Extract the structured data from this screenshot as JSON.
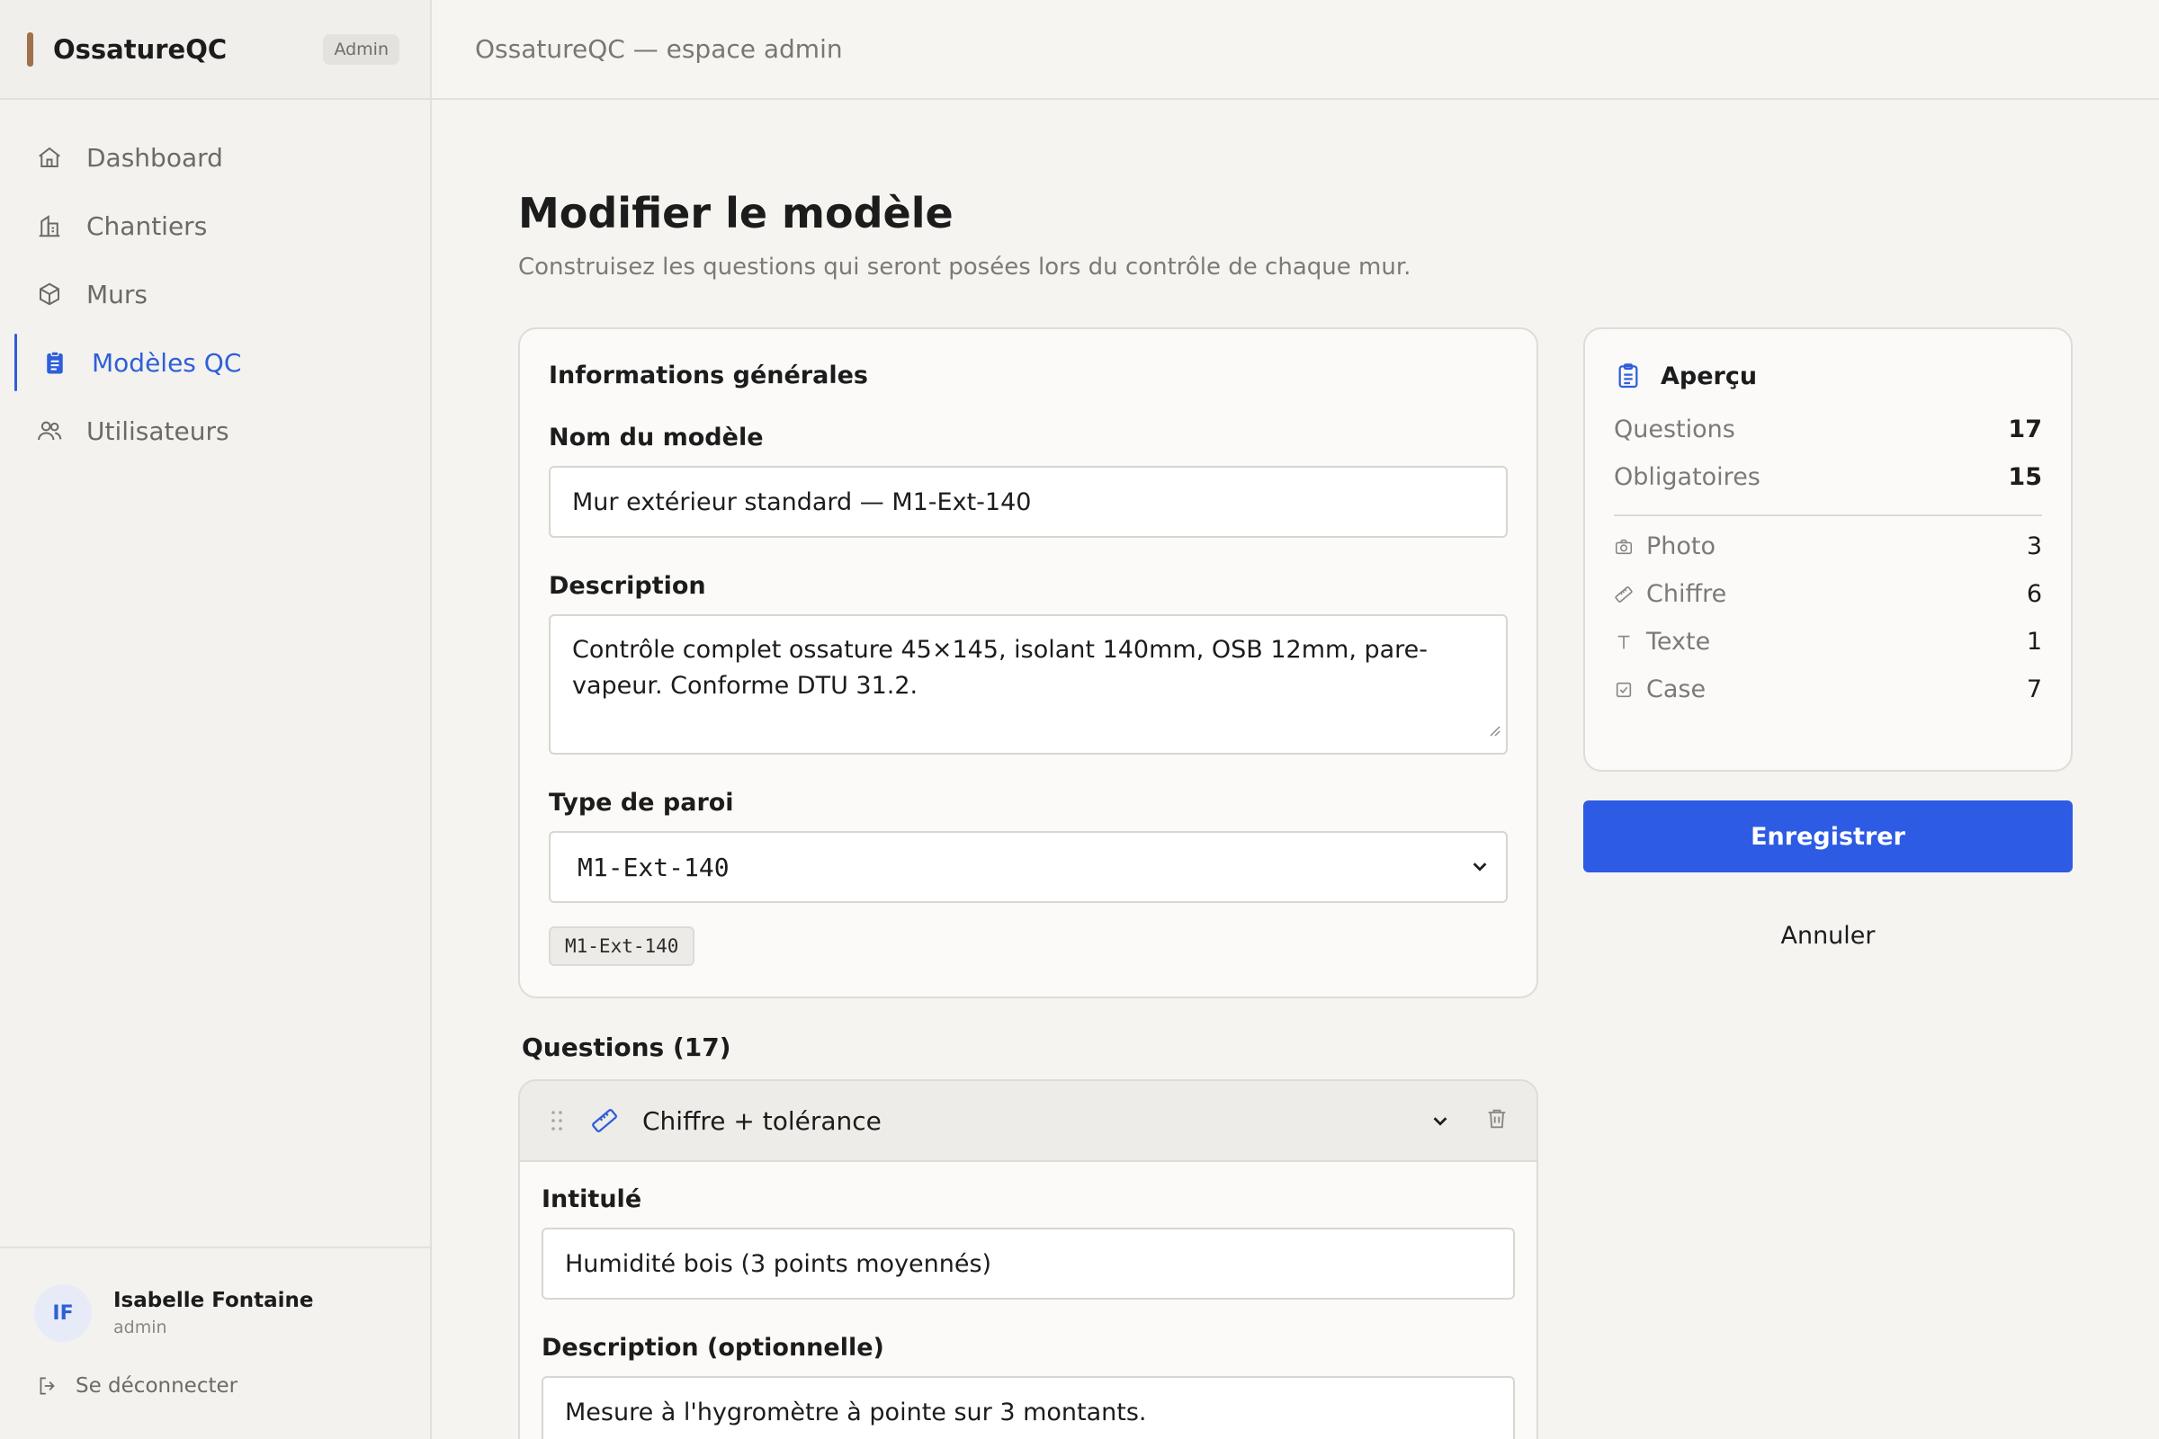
{
  "app": {
    "name": "OssatureQC",
    "badge": "Admin",
    "topbar_title": "OssatureQC — espace admin"
  },
  "sidebar": {
    "items": [
      {
        "label": "Dashboard",
        "icon": "home-icon"
      },
      {
        "label": "Chantiers",
        "icon": "building-icon"
      },
      {
        "label": "Murs",
        "icon": "cube-icon"
      },
      {
        "label": "Modèles QC",
        "icon": "clipboard-icon"
      },
      {
        "label": "Utilisateurs",
        "icon": "users-icon"
      }
    ],
    "active": "Modèles QC",
    "user": {
      "initials": "IF",
      "name": "Isabelle Fontaine",
      "role": "admin"
    },
    "logout_label": "Se déconnecter"
  },
  "page": {
    "title": "Modifier le modèle",
    "subtitle": "Construisez les questions qui seront posées lors du contrôle de chaque mur."
  },
  "general": {
    "section_title": "Informations générales",
    "name_label": "Nom du modèle",
    "name_value": "Mur extérieur standard — M1-Ext-140",
    "description_label": "Description",
    "description_value": "Contrôle complet ossature 45×145, isolant 140mm, OSB 12mm, pare-vapeur. Conforme DTU 31.2.",
    "wall_type_label": "Type de paroi",
    "wall_type_value": "M1-Ext-140",
    "wall_type_chip": "M1-Ext-140"
  },
  "questions": {
    "heading": "Questions (17)",
    "first": {
      "type_label": "Chiffre + tolérance",
      "title_label": "Intitulé",
      "title_value": "Humidité bois (3 points moyennés)",
      "desc_label": "Description (optionnelle)",
      "desc_value": "Mesure à l'hygromètre à pointe sur 3 montants."
    }
  },
  "preview": {
    "title": "Aperçu",
    "questions_label": "Questions",
    "questions_value": "17",
    "required_label": "Obligatoires",
    "required_value": "15",
    "types": [
      {
        "label": "Photo",
        "value": "3",
        "icon": "camera-icon"
      },
      {
        "label": "Chiffre",
        "value": "6",
        "icon": "ruler-icon"
      },
      {
        "label": "Texte",
        "value": "1",
        "icon": "text-icon"
      },
      {
        "label": "Case",
        "value": "7",
        "icon": "checkbox-icon"
      }
    ]
  },
  "actions": {
    "save_label": "Enregistrer",
    "cancel_label": "Annuler"
  },
  "colors": {
    "accent": "#2d5be3",
    "brand": "#a0714a"
  }
}
